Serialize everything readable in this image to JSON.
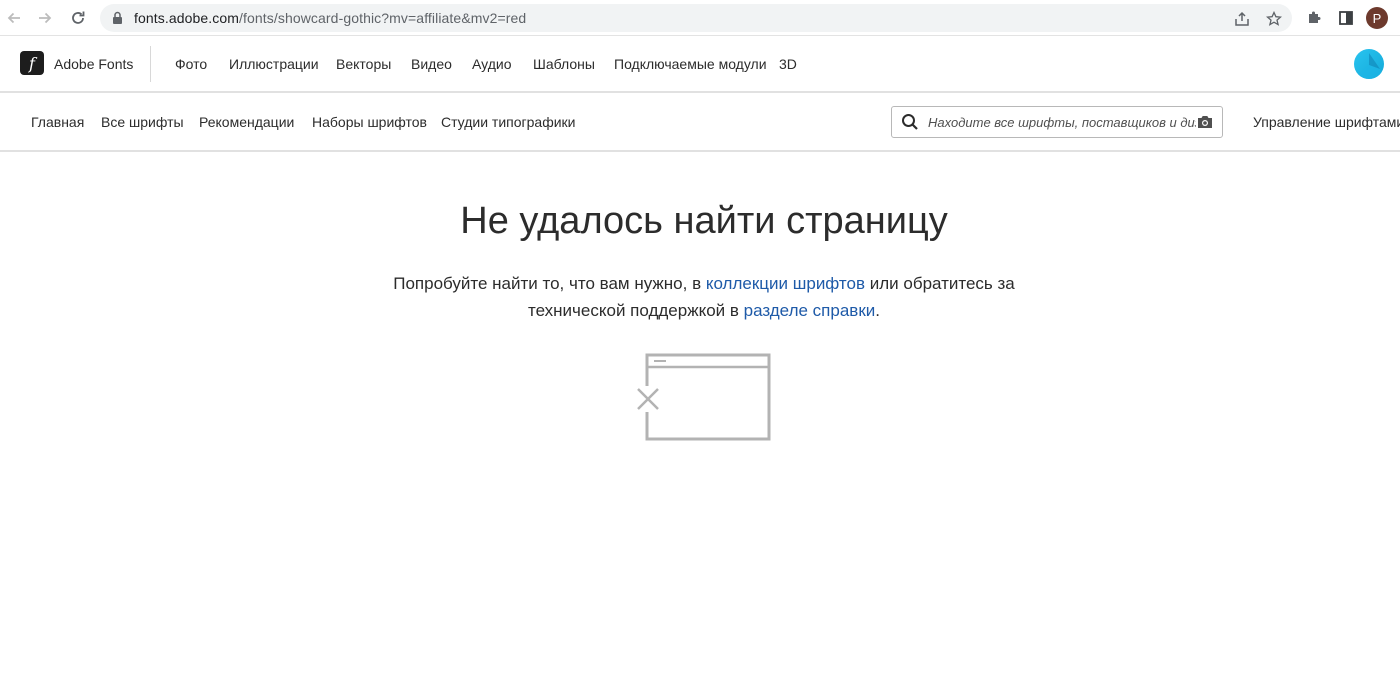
{
  "browser": {
    "url_host": "fonts.adobe.com",
    "url_path": "/fonts/showcard-gothic?mv=affiliate&mv2=red",
    "profile_initial": "P"
  },
  "global_nav": {
    "brand": "Adobe Fonts",
    "items": [
      "Фото",
      "Иллюстрации",
      "Векторы",
      "Видео",
      "Аудио",
      "Шаблоны",
      "Подключаемые модули",
      "3D"
    ]
  },
  "sub_nav": {
    "items": [
      "Главная",
      "Все шрифты",
      "Рекомендации",
      "Наборы шрифтов",
      "Студии типографики"
    ],
    "search_placeholder": "Находите все шрифты, поставщиков и диза...",
    "manage_fonts": "Управление шрифтами"
  },
  "main": {
    "title": "Не удалось найти страницу",
    "message_part1": "Попробуйте найти то, что вам нужно, в ",
    "link1": "коллекции шрифтов",
    "message_part2": " или обратитесь за",
    "message_part3": "технической поддержкой в ",
    "link2": "разделе справки",
    "message_part4": "."
  },
  "colors": {
    "link": "#1e5aa8",
    "illustration_stroke": "#b3b3b3"
  },
  "icons": {
    "back": "arrow-left-icon",
    "forward": "arrow-right-icon",
    "reload": "reload-icon",
    "lock": "lock-icon",
    "share": "share-icon",
    "bookmark": "star-icon",
    "extensions": "puzzle-icon",
    "side_panel": "side-panel-icon",
    "search": "search-icon",
    "camera": "camera-icon",
    "error_illustration": "broken-window-icon"
  }
}
